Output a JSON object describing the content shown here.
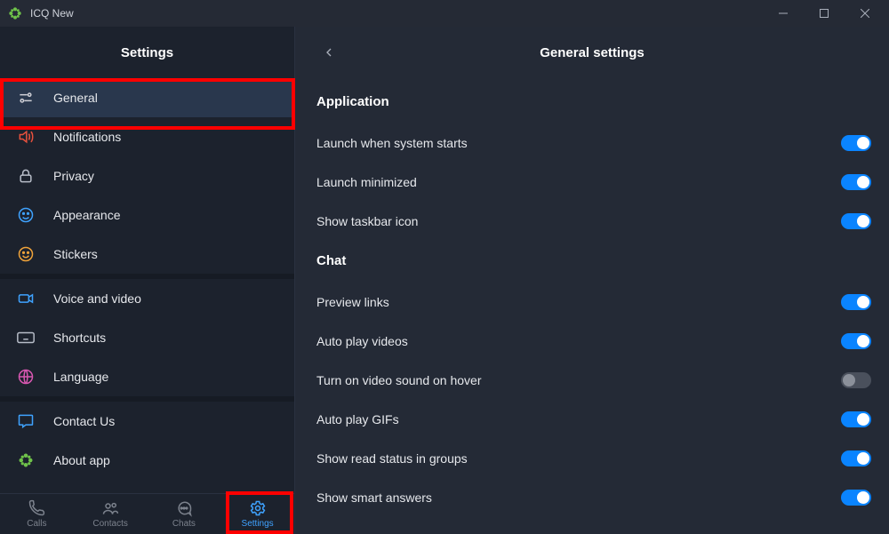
{
  "window": {
    "title": "ICQ New"
  },
  "sidebar": {
    "title": "Settings",
    "items": [
      {
        "label": "General",
        "icon": "sliders-icon",
        "active": true
      },
      {
        "label": "Notifications",
        "icon": "volume-icon",
        "active": false
      },
      {
        "label": "Privacy",
        "icon": "lock-icon",
        "active": false
      },
      {
        "label": "Appearance",
        "icon": "smile-icon",
        "active": false
      },
      {
        "label": "Stickers",
        "icon": "sticker-icon",
        "active": false
      }
    ],
    "items2": [
      {
        "label": "Voice and video",
        "icon": "camera-icon",
        "active": false
      },
      {
        "label": "Shortcuts",
        "icon": "keyboard-icon",
        "active": false
      },
      {
        "label": "Language",
        "icon": "globe-icon",
        "active": false
      }
    ],
    "items3": [
      {
        "label": "Contact Us",
        "icon": "chat-icon",
        "active": false
      },
      {
        "label": "About app",
        "icon": "flower-icon",
        "active": false
      }
    ]
  },
  "bottom_nav": {
    "items": [
      {
        "label": "Calls",
        "icon": "phone-icon"
      },
      {
        "label": "Contacts",
        "icon": "people-icon"
      },
      {
        "label": "Chats",
        "icon": "chat-bubble-icon"
      },
      {
        "label": "Settings",
        "icon": "gear-icon",
        "active": true
      }
    ]
  },
  "content": {
    "title": "General settings",
    "sections": [
      {
        "heading": "Application",
        "rows": [
          {
            "label": "Launch when system starts",
            "on": true
          },
          {
            "label": "Launch minimized",
            "on": true
          },
          {
            "label": "Show taskbar icon",
            "on": true
          }
        ]
      },
      {
        "heading": "Chat",
        "rows": [
          {
            "label": "Preview links",
            "on": true
          },
          {
            "label": "Auto play videos",
            "on": true
          },
          {
            "label": "Turn on video sound on hover",
            "on": false
          },
          {
            "label": "Auto play GIFs",
            "on": true
          },
          {
            "label": "Show read status in groups",
            "on": true
          },
          {
            "label": "Show smart answers",
            "on": true
          }
        ]
      }
    ]
  }
}
